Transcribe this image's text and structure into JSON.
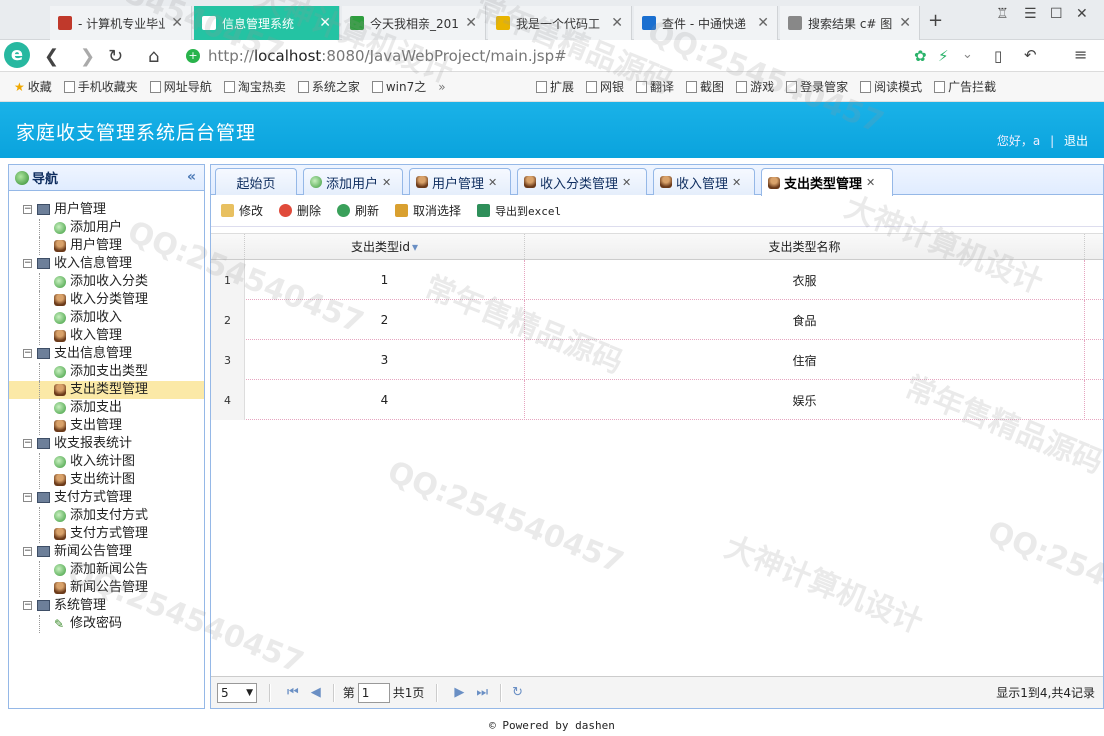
{
  "browser": {
    "tabs": [
      {
        "title": "- 计算机专业毕业",
        "color": "#c0392b"
      },
      {
        "title": "信息管理系统",
        "color": "#ffffff"
      },
      {
        "title": "今天我相亲_201",
        "color": "#2e9e3e"
      },
      {
        "title": "我是一个代码工",
        "color": "#e8b400"
      },
      {
        "title": "查件 - 中通快递",
        "color": "#1a6fd0"
      },
      {
        "title": "搜索结果 c# 图",
        "color": "#888888"
      }
    ],
    "new_tab": "+",
    "url_prefix": "http://",
    "url_host": "localhost",
    "url_rest": ":8080/JavaWebProject/main.jsp#",
    "bookmarks": [
      "收藏",
      "手机收藏夹",
      "网址导航",
      "淘宝热卖",
      "系统之家",
      "win7之"
    ],
    "bookmarks_more": "»",
    "toolbar_right": [
      "扩展",
      "网银",
      "翻译",
      "截图",
      "游戏",
      "登录管家",
      "阅读模式",
      "广告拦截"
    ]
  },
  "header": {
    "title": "家庭收支管理系统后台管理",
    "greeting": "您好，a",
    "sep": "|",
    "logout": "退出"
  },
  "nav": {
    "title": "导航",
    "collapse": "«",
    "groups": [
      {
        "label": "用户管理",
        "items": [
          {
            "label": "添加用户",
            "icon": "add"
          },
          {
            "label": "用户管理",
            "icon": "user"
          }
        ]
      },
      {
        "label": "收入信息管理",
        "items": [
          {
            "label": "添加收入分类",
            "icon": "add"
          },
          {
            "label": "收入分类管理",
            "icon": "user"
          },
          {
            "label": "添加收入",
            "icon": "add"
          },
          {
            "label": "收入管理",
            "icon": "user"
          }
        ]
      },
      {
        "label": "支出信息管理",
        "items": [
          {
            "label": "添加支出类型",
            "icon": "add"
          },
          {
            "label": "支出类型管理",
            "icon": "user",
            "selected": true
          },
          {
            "label": "添加支出",
            "icon": "add"
          },
          {
            "label": "支出管理",
            "icon": "user"
          }
        ]
      },
      {
        "label": "收支报表统计",
        "items": [
          {
            "label": "收入统计图",
            "icon": "add"
          },
          {
            "label": "支出统计图",
            "icon": "user"
          }
        ]
      },
      {
        "label": "支付方式管理",
        "items": [
          {
            "label": "添加支付方式",
            "icon": "add"
          },
          {
            "label": "支付方式管理",
            "icon": "user"
          }
        ]
      },
      {
        "label": "新闻公告管理",
        "items": [
          {
            "label": "添加新闻公告",
            "icon": "add"
          },
          {
            "label": "新闻公告管理",
            "icon": "user"
          }
        ]
      },
      {
        "label": "系统管理",
        "items": [
          {
            "label": "修改密码",
            "icon": "pen"
          }
        ]
      }
    ]
  },
  "tabs": [
    {
      "label": "起始页",
      "closable": false,
      "icon": ""
    },
    {
      "label": "添加用户",
      "closable": true,
      "icon": "add"
    },
    {
      "label": "用户管理",
      "closable": true,
      "icon": "user"
    },
    {
      "label": "收入分类管理",
      "closable": true,
      "icon": "user"
    },
    {
      "label": "收入管理",
      "closable": true,
      "icon": "user"
    },
    {
      "label": "支出类型管理",
      "closable": true,
      "icon": "user",
      "active": true
    }
  ],
  "toolbar": {
    "edit": "修改",
    "delete": "删除",
    "refresh": "刷新",
    "unselect": "取消选择",
    "export": "导出到excel"
  },
  "grid": {
    "columns": [
      "支出类型id",
      "支出类型名称"
    ],
    "sort_indicator": "▾",
    "rows": [
      {
        "n": "1",
        "id": "1",
        "name": "衣服"
      },
      {
        "n": "2",
        "id": "2",
        "name": "食品"
      },
      {
        "n": "3",
        "id": "3",
        "name": "住宿"
      },
      {
        "n": "4",
        "id": "4",
        "name": "娱乐"
      }
    ]
  },
  "pager": {
    "page_size": "5",
    "page_prefix": "第",
    "page_value": "1",
    "page_suffix": "共1页",
    "info": "显示1到4,共4记录"
  },
  "footer": "© Powered by dashen",
  "watermarks": [
    "QQ:254540457",
    "大神计算机设计",
    "常年售精品源码",
    "QQ:254540457",
    "大神计算机设计",
    "常年售精品源码",
    "QQ:254540457",
    "QQ:254540457",
    "大神计算机设计",
    "常年售精品源码",
    "QQ:254540457",
    "QQ:254540457"
  ]
}
